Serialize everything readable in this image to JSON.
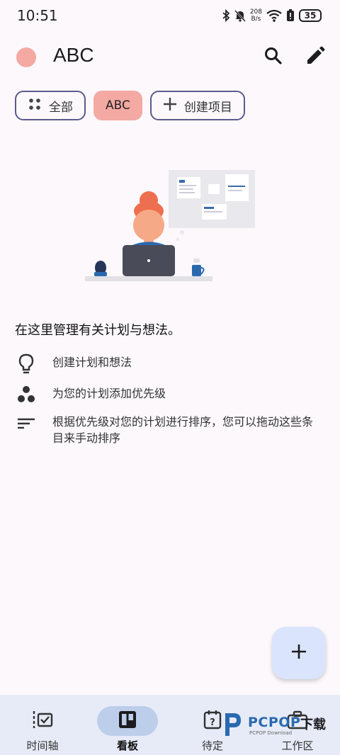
{
  "status_bar": {
    "time": "10:51",
    "net_speed_value": "208",
    "net_speed_unit": "B/s",
    "battery": "35",
    "icons": [
      "bluetooth-icon",
      "bell-muted-icon",
      "wifi-icon",
      "battery-saver-icon",
      "battery-icon"
    ]
  },
  "header": {
    "title": "ABC",
    "project_color": "#f4a9a3",
    "search_icon": "search-icon",
    "edit_icon": "edit-icon"
  },
  "chips": {
    "all_label": "全部",
    "project_label": "ABC",
    "create_label": "创建项目"
  },
  "empty_state": {
    "intro": "在这里管理有关计划与想法。",
    "features": [
      {
        "icon": "lightbulb-icon",
        "text": "创建计划和想法"
      },
      {
        "icon": "priority-dots-icon",
        "text": "为您的计划添加优先级"
      },
      {
        "icon": "sort-lines-icon",
        "text": "根据优先级对您的计划进行排序，您可以拖动这些条目来手动排序"
      }
    ]
  },
  "fab": {
    "icon": "plus-icon"
  },
  "bottom_nav": {
    "items": [
      {
        "label": "时间轴",
        "icon": "timeline-icon",
        "active": false
      },
      {
        "label": "看板",
        "icon": "board-icon",
        "active": true
      },
      {
        "label": "待定",
        "icon": "pending-icon",
        "active": false
      },
      {
        "label": "工作区",
        "icon": "workspace-icon",
        "active": false
      }
    ]
  },
  "watermark": {
    "brand": "PCPOP",
    "suffix": "下载",
    "sub": "PCPOP Download"
  },
  "colors": {
    "background": "#fcf8fc",
    "accent_chip": "#f4a9a3",
    "chip_border": "#5c5a8c",
    "fab": "#dbe4fd",
    "nav_bg": "#e6ebf7",
    "nav_active": "#bccee9"
  }
}
